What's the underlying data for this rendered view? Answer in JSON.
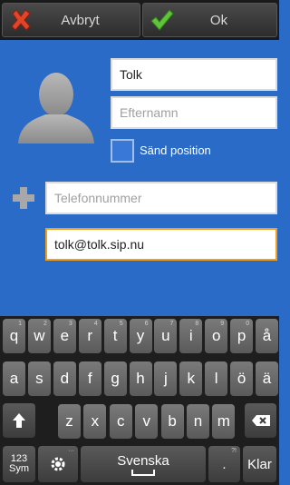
{
  "topbar": {
    "cancel_label": "Avbryt",
    "ok_label": "Ok",
    "cancel_icon": "red-x-icon",
    "ok_icon": "green-check-icon"
  },
  "form": {
    "first_name": {
      "value": "Tolk",
      "placeholder": ""
    },
    "last_name": {
      "value": "",
      "placeholder": "Efternamn"
    },
    "send_position_label": "Sänd position",
    "send_position_checked": false,
    "phone": {
      "value": "",
      "placeholder": "Telefonnummer"
    },
    "sip_address": {
      "value": "tolk@tolk.sip.nu"
    }
  },
  "keyboard": {
    "row1": [
      {
        "key": "q",
        "alt": "1"
      },
      {
        "key": "w",
        "alt": "2"
      },
      {
        "key": "e",
        "alt": "3"
      },
      {
        "key": "r",
        "alt": "4"
      },
      {
        "key": "t",
        "alt": "5"
      },
      {
        "key": "y",
        "alt": "6"
      },
      {
        "key": "u",
        "alt": "7"
      },
      {
        "key": "i",
        "alt": "8"
      },
      {
        "key": "o",
        "alt": "9"
      },
      {
        "key": "p",
        "alt": "0"
      },
      {
        "key": "å",
        "alt": ""
      }
    ],
    "row2": [
      "a",
      "s",
      "d",
      "f",
      "g",
      "h",
      "j",
      "k",
      "l",
      "ö",
      "ä"
    ],
    "row3": [
      "z",
      "x",
      "c",
      "v",
      "b",
      "n",
      "m"
    ],
    "sym_label_1": "123",
    "sym_label_2": "Sym",
    "space_label": "Svenska",
    "period": ".",
    "enter_label": "Klar"
  },
  "colors": {
    "background": "#2a6bc7",
    "focus_border": "#f0a020"
  }
}
